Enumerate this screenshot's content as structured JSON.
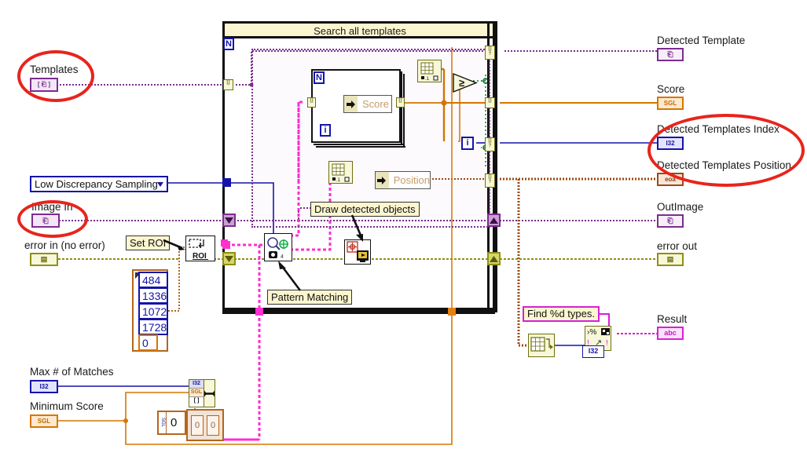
{
  "app": {
    "title": "Search all templates",
    "type": "labview-block-diagram"
  },
  "structures": {
    "outer_loop_label": "Search all templates",
    "outer_loop_count": "N",
    "inner_loop_count": "N",
    "inner_loop_index": "i",
    "outer_loop_index": "i"
  },
  "inputs": {
    "templates": {
      "label": "Templates",
      "type_glyph": "[ ⎗ ]"
    },
    "image_in": {
      "label": "Image In",
      "type_glyph": "⎗"
    },
    "error_in": {
      "label": "error in (no error)",
      "type_glyph": "▤"
    },
    "sampling": {
      "label": "Low Discrepancy Sampling"
    },
    "max_matches": {
      "label": "Max # of Matches",
      "type_glyph": "I32"
    },
    "minimum_score": {
      "label": "Minimum Score",
      "type_glyph": "SGL"
    }
  },
  "outputs": {
    "detected_template": {
      "label": "Detected Template",
      "type_glyph": "⎗"
    },
    "score": {
      "label": "Score",
      "type_glyph": "SGL"
    },
    "detected_templates_index": {
      "label": "Detected Templates Index",
      "type_glyph": "I32"
    },
    "detected_templates_position": {
      "label": "Detected Templates Position",
      "type_glyph": "eoa"
    },
    "out_image": {
      "label": "OutImage",
      "type_glyph": "⎗"
    },
    "error_out": {
      "label": "error out",
      "type_glyph": "▤"
    },
    "result": {
      "label": "Result",
      "type_glyph": "abc"
    }
  },
  "comments": {
    "set_roi": "Set ROI",
    "pattern_matching": "Pattern Matching",
    "draw_detected": "Draw detected objects",
    "find_types": "Find %d types."
  },
  "bundles": {
    "score_label": "Score",
    "position_label": "Position",
    "roi_label": "ROI"
  },
  "constants": {
    "roi_array": [
      "484",
      "1336",
      "1072",
      "1728",
      "0"
    ],
    "min_score_default": "0",
    "pattern_matching_count": "4",
    "format_int": "I32"
  },
  "annotations": {
    "highlight_count": 3,
    "highlight_color": "#e8241c",
    "highlighted": [
      "Templates",
      "Image In",
      "Detected Templates Index / Detected Templates Position"
    ]
  },
  "colors": {
    "image_wire": "#7b2d8e",
    "error_wire": "#8f8f16",
    "sgl_wire": "#d77600",
    "i32_wire": "#1414aa",
    "cluster_wire": "#9c4a14",
    "string_wire": "#d81fd8",
    "pink_wire": "#ff2fd0",
    "annotation": "#e8241c",
    "loop_banner": "#fbf6cf"
  }
}
